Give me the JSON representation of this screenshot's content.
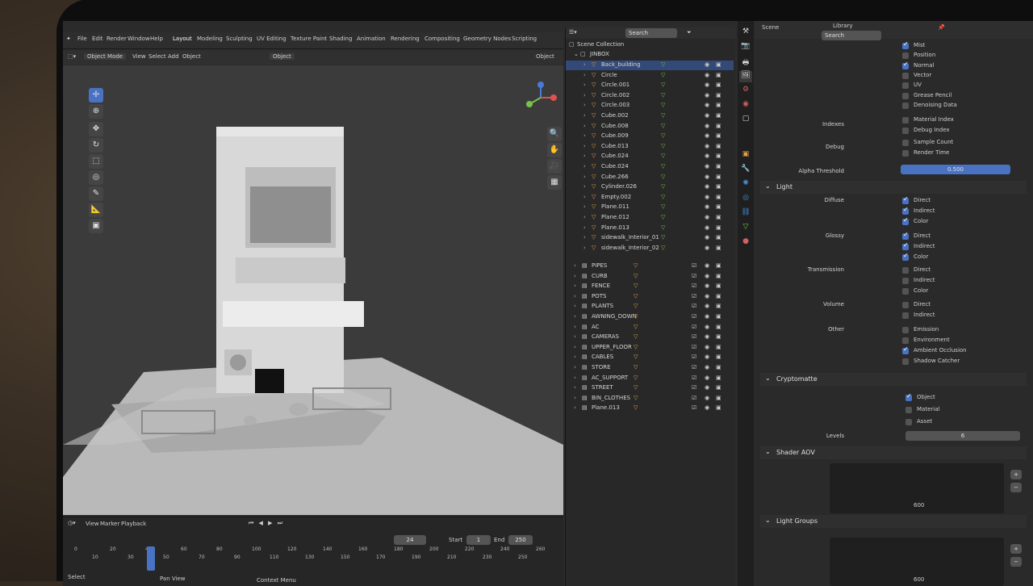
{
  "app": {
    "workspace_tabs": [
      "Layout",
      "Modeling",
      "Sculpting",
      "UV Editing",
      "Texture Paint",
      "Shading",
      "Animation",
      "Rendering",
      "Compositing",
      "Geometry Nodes",
      "Scripting"
    ],
    "main_menu": [
      "File",
      "Edit",
      "Render",
      "Window",
      "Help"
    ]
  },
  "viewport_header": {
    "mode": "Object Mode",
    "menus": [
      "View",
      "Select",
      "Add",
      "Object"
    ],
    "transform": "Object",
    "orientation": "Object"
  },
  "timeline": {
    "menus": [
      "View",
      "Marker",
      "Playback"
    ],
    "frames": [
      "0",
      "10",
      "20",
      "30",
      "40",
      "50",
      "60",
      "70",
      "80",
      "90",
      "100",
      "110",
      "120",
      "130",
      "140",
      "150",
      "160",
      "170",
      "180",
      "190",
      "200",
      "210",
      "220",
      "230",
      "240",
      "250",
      "260"
    ],
    "current_frame": "24",
    "start_label": "Start",
    "start_value": "1",
    "end_label": "End",
    "end_value": "250",
    "status_select": "Select",
    "status_pan": "Pan View",
    "status_context": "Context Menu"
  },
  "outliner": {
    "search_placeholder": "Search",
    "scene_collection": "Scene Collection",
    "root": "JINBOX",
    "items": [
      "Back_building",
      "Circle",
      "Circle.001",
      "Circle.002",
      "Circle.003",
      "Cube.002",
      "Cube.008",
      "Cube.009",
      "Cube.013",
      "Cube.024",
      "Cube.024",
      "Cube.266",
      "Cylinder.026",
      "Empty.002",
      "Plane.011",
      "Plane.012",
      "Plane.013",
      "sidewalk_Interior_01",
      "sidewalk_Interior_02"
    ],
    "collections": [
      "PIPES",
      "CURB",
      "FENCE",
      "POTS",
      "PLANTS",
      "AWNING_DOWN",
      "AC",
      "CAMERAS",
      "UPPER_FLOOR",
      "CABLES",
      "STORE",
      "AC_SUPPORT",
      "STREET",
      "BIN_CLOTHES",
      "Plane.013"
    ]
  },
  "properties": {
    "header_title": "Scene",
    "header_sub": "Library",
    "search_placeholder": "Search",
    "passes_top": [
      {
        "label": "Mist",
        "on": true
      },
      {
        "label": "Position",
        "on": false
      },
      {
        "label": "Normal",
        "on": true
      },
      {
        "label": "Vector",
        "on": false
      },
      {
        "label": "UV",
        "on": false
      },
      {
        "label": "Grease Pencil",
        "on": false
      },
      {
        "label": "Denoising Data",
        "on": false
      }
    ],
    "indexes_label": "Indexes",
    "indexes": [
      {
        "label": "Material Index",
        "on": false
      },
      {
        "label": "Debug Index",
        "on": false
      }
    ],
    "debug_label": "Debug",
    "debug": [
      {
        "label": "Sample Count",
        "on": false
      },
      {
        "label": "Render Time",
        "on": false
      }
    ],
    "alpha_label": "Alpha Threshold",
    "alpha_value": "0.500",
    "light_section": "Light",
    "diffuse_label": "Diffuse",
    "diffuse": [
      {
        "label": "Direct",
        "on": true
      },
      {
        "label": "Indirect",
        "on": true
      },
      {
        "label": "Color",
        "on": true
      }
    ],
    "glossy_label": "Glossy",
    "glossy": [
      {
        "label": "Direct",
        "on": true
      },
      {
        "label": "Indirect",
        "on": true
      },
      {
        "label": "Color",
        "on": true
      }
    ],
    "transmission_label": "Transmission",
    "transmission": [
      {
        "label": "Direct",
        "on": false
      },
      {
        "label": "Indirect",
        "on": false
      },
      {
        "label": "Color",
        "on": false
      }
    ],
    "volume_label": "Volume",
    "volume": [
      {
        "label": "Direct",
        "on": false
      },
      {
        "label": "Indirect",
        "on": false
      }
    ],
    "other_label": "Other",
    "other": [
      {
        "label": "Emission",
        "on": false
      },
      {
        "label": "Environment",
        "on": false
      },
      {
        "label": "Ambient Occlusion",
        "on": true
      },
      {
        "label": "Shadow Catcher",
        "on": false
      }
    ],
    "crypto_section": "Cryptomatte",
    "crypto": [
      {
        "label": "Object",
        "on": true
      },
      {
        "label": "Material",
        "on": false
      },
      {
        "label": "Asset",
        "on": false
      }
    ],
    "levels_label": "Levels",
    "levels_value": "6",
    "shader_aov_section": "Shader AOV",
    "aov_value": "600",
    "light_groups_section": "Light Groups",
    "lg_value": "600",
    "bottom_section": "Light Groups"
  }
}
